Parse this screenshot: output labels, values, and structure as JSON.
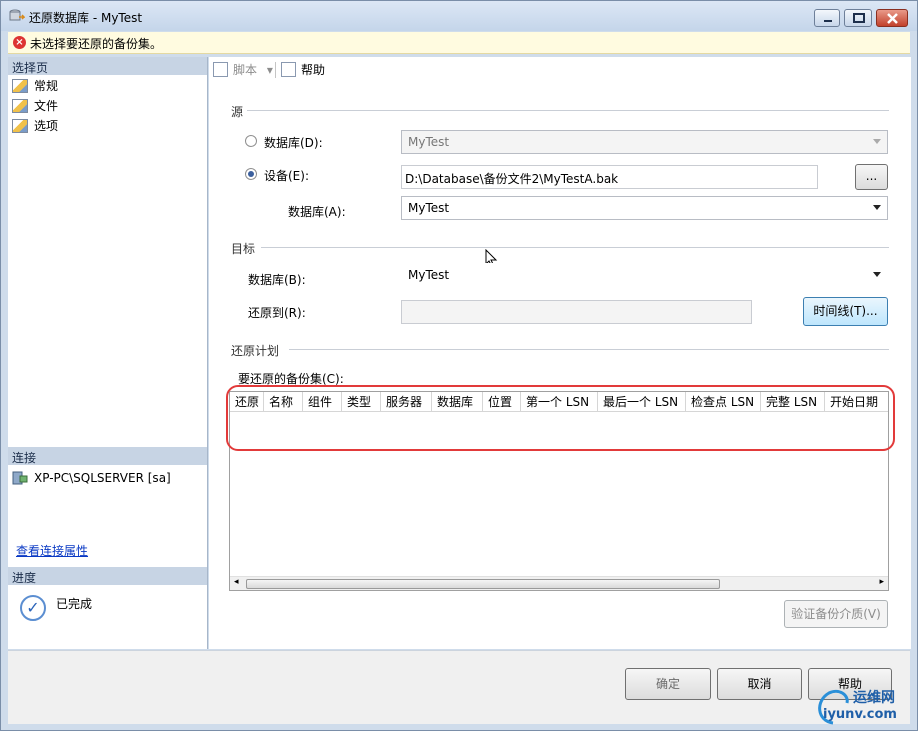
{
  "window": {
    "title": "还原数据库 - MyTest"
  },
  "error": {
    "message": "未选择要还原的备份集。"
  },
  "left": {
    "select_page_header": "选择页",
    "pages": [
      "常规",
      "文件",
      "选项"
    ],
    "connection_header": "连接",
    "server": "XP-PC\\SQLSERVER [sa]",
    "view_conn_props": "查看连接属性",
    "progress_header": "进度",
    "progress_status": "已完成"
  },
  "toolbar": {
    "script": "脚本",
    "help": "帮助"
  },
  "source": {
    "section": "源",
    "database_label": "数据库(D):",
    "database_value": "MyTest",
    "device_label": "设备(E):",
    "device_value": "D:\\Database\\备份文件2\\MyTestA.bak",
    "browse": "...",
    "database_a_label": "数据库(A):",
    "database_a_value": "MyTest"
  },
  "target": {
    "section": "目标",
    "database_label": "数据库(B):",
    "database_value": "MyTest",
    "restore_to_label": "还原到(R):",
    "restore_to_value": "",
    "timeline_button": "时间线(T)..."
  },
  "plan": {
    "section": "还原计划",
    "backup_sets_label": "要还原的备份集(C):",
    "columns": [
      "还原",
      "名称",
      "组件",
      "类型",
      "服务器",
      "数据库",
      "位置",
      "第一个 LSN",
      "最后一个 LSN",
      "检查点 LSN",
      "完整 LSN",
      "开始日期"
    ],
    "verify_button": "验证备份介质(V)"
  },
  "buttons": {
    "ok": "确定",
    "cancel": "取消",
    "help": "帮助"
  },
  "watermark": {
    "brand": "运维网",
    "url": "iyunv.com"
  }
}
